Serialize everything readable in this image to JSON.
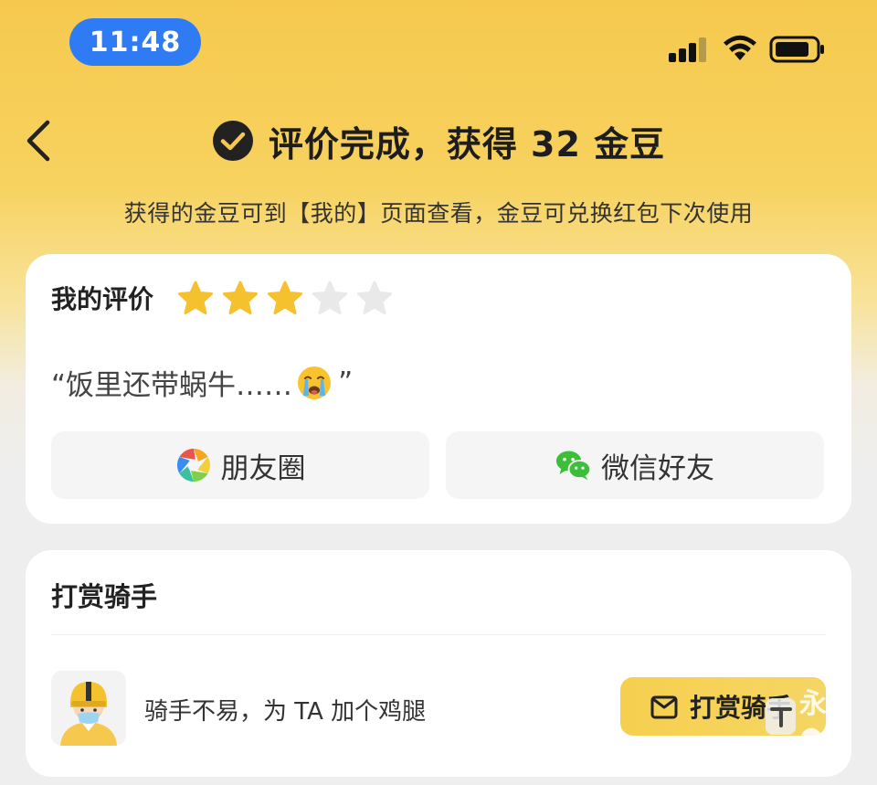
{
  "status_bar": {
    "time": "11:48"
  },
  "header": {
    "title": "评价完成，获得 32 金豆",
    "subtitle": "获得的金豆可到【我的】页面查看，金豆可兑换红包下次使用"
  },
  "review": {
    "label": "我的评价",
    "rating": 3,
    "max_rating": 5,
    "comment_open": "“饭里还带蜗牛……",
    "comment_close": "”",
    "share_moments": "朋友圈",
    "share_wechat": "微信好友"
  },
  "tip": {
    "title": "打赏骑手",
    "text": "骑手不易，为 TA 加个鸡腿",
    "button": "打赏骑手"
  },
  "watermark": {
    "text": "永●●"
  },
  "colors": {
    "accent_yellow": "#f6c94e",
    "star_on": "#f5c12e",
    "star_off": "#e9e9e9",
    "time_pill": "#2f7bf4",
    "wechat_green": "#3ebd3a"
  }
}
